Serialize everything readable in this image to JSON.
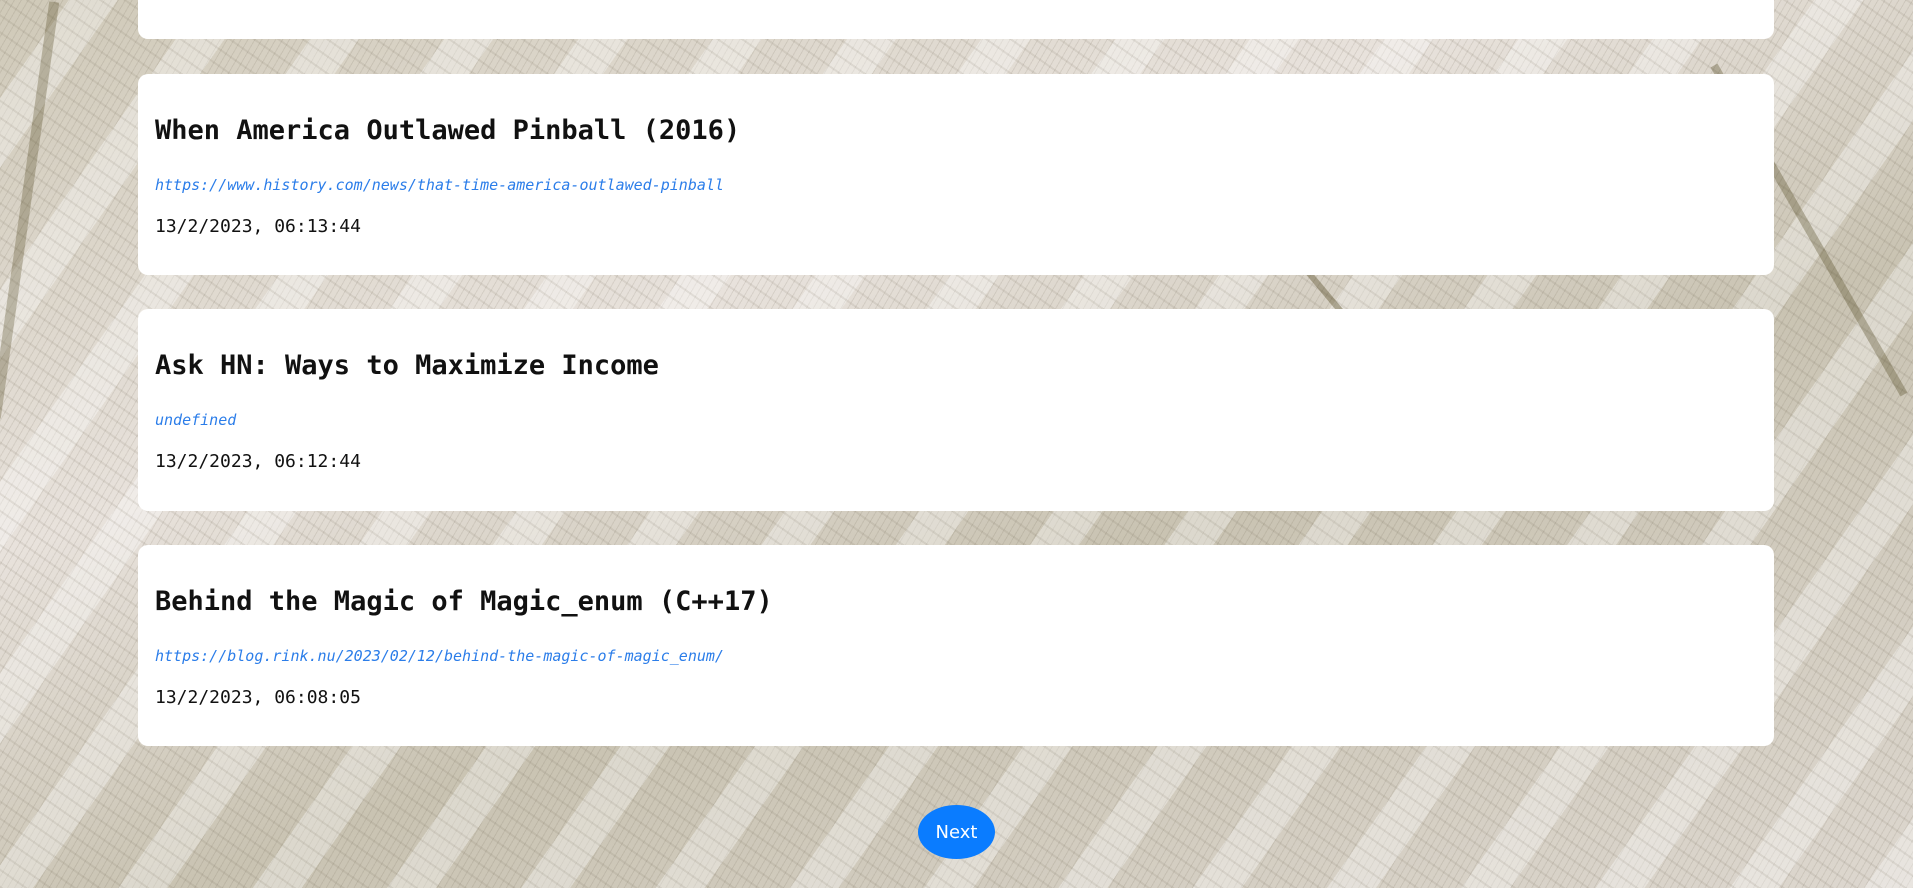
{
  "posts": [
    {
      "title": "When America Outlawed Pinball (2016)",
      "url": "https://www.history.com/news/that-time-america-outlawed-pinball",
      "timestamp": "13/2/2023, 06:13:44"
    },
    {
      "title": "Ask HN: Ways to Maximize Income",
      "url": "undefined",
      "timestamp": "13/2/2023, 06:12:44"
    },
    {
      "title": "Behind the Magic of Magic_enum (C++17)",
      "url": "https://blog.rink.nu/2023/02/12/behind-the-magic-of-magic_enum/",
      "timestamp": "13/2/2023, 06:08:05"
    }
  ],
  "pagination": {
    "next_label": "Next"
  },
  "colors": {
    "link": "#2b7de9",
    "button": "#0a7cff",
    "card": "#ffffff"
  }
}
